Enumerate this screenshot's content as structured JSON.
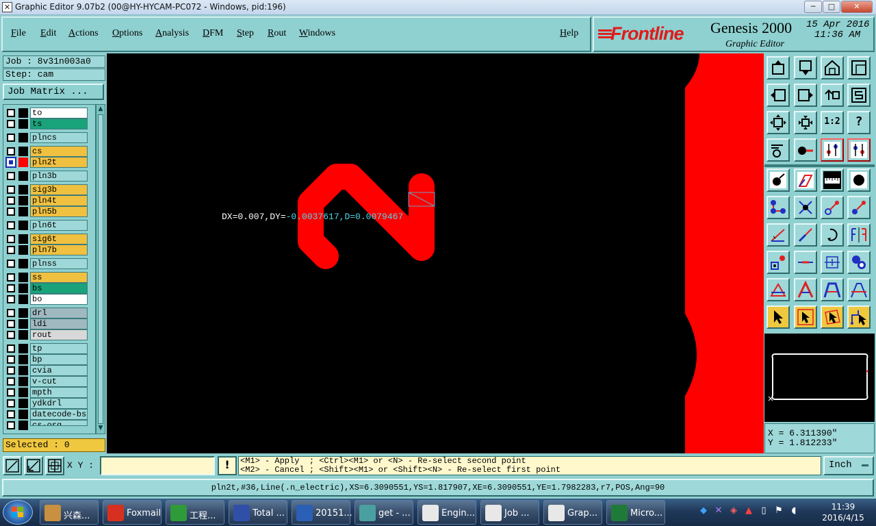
{
  "window": {
    "title": "Graphic Editor 9.07b2 (00@HY-HYCAM-PC072 - Windows, pid:196)",
    "minimize": "─",
    "maximize": "□",
    "close": "✕"
  },
  "menu": {
    "items": [
      "File",
      "Edit",
      "Actions",
      "Options",
      "Analysis",
      "DFM",
      "Step",
      "Rout",
      "Windows"
    ],
    "help": "Help"
  },
  "brand": {
    "logo": "Frontline",
    "product": "Genesis 2000",
    "subtitle": "Graphic Editor",
    "date": "15 Apr 2016",
    "time": "11:36 AM"
  },
  "job": {
    "job_line": "Job : 8v31n003a0",
    "step_line": "Step: cam",
    "matrix_button": "Job Matrix ..."
  },
  "layers": [
    {
      "name": "to",
      "color": "#ffffff"
    },
    {
      "name": "ts",
      "color": "#1aa37a"
    },
    {
      "name": "plncs",
      "color": "#9ed8d8"
    },
    {
      "name": "cs",
      "color": "#f0c040"
    },
    {
      "name": "pln2t",
      "color": "#f0c040",
      "selected": true
    },
    {
      "name": "pln3b",
      "color": "#9ed8d8"
    },
    {
      "name": "sig3b",
      "color": "#f0c040"
    },
    {
      "name": "pln4t",
      "color": "#f0c040"
    },
    {
      "name": "pln5b",
      "color": "#f0c040"
    },
    {
      "name": "pln6t",
      "color": "#9ed8d8"
    },
    {
      "name": "sig6t",
      "color": "#f0c040"
    },
    {
      "name": "pln7b",
      "color": "#f0c040"
    },
    {
      "name": "plnss",
      "color": "#9ed8d8"
    },
    {
      "name": "ss",
      "color": "#f0c040"
    },
    {
      "name": "bs",
      "color": "#1aa37a"
    },
    {
      "name": "bo",
      "color": "#ffffff"
    },
    {
      "name": "drl",
      "color": "#a0b8c0"
    },
    {
      "name": "ldi",
      "color": "#a0b8c0"
    },
    {
      "name": "rout",
      "color": "#d8d8d8"
    },
    {
      "name": "tp",
      "color": "#9ed8d8"
    },
    {
      "name": "bp",
      "color": "#9ed8d8"
    },
    {
      "name": "cvia",
      "color": "#9ed8d8"
    },
    {
      "name": "v-cut",
      "color": "#9ed8d8"
    },
    {
      "name": "mpth",
      "color": "#9ed8d8"
    },
    {
      "name": "ydkdrl",
      "color": "#9ed8d8"
    },
    {
      "name": "datecode-bs",
      "color": "#9ed8d8"
    },
    {
      "name": "cs-org",
      "color": "#9ed8d8"
    }
  ],
  "selected_count": "Selected : 0",
  "measurement": {
    "dx": "DX=0.007,DY=",
    "dy": "-0.0037617,",
    "d": "D=0.0079467"
  },
  "tools": {
    "zoom_ratio_label": "1:2",
    "help_label": "?"
  },
  "coords": {
    "x": "X = 6.311390\"",
    "y": "Y = 1.812233\""
  },
  "statusbar": {
    "xy_label": "X Y :",
    "xy_value": "",
    "warn": "!",
    "prompt_line1": "<M1> - Apply  ; <Ctrl><M1> or <N> - Re-select second point",
    "prompt_line2": "<M2> - Cancel ; <Shift><M1> or <Shift><N> - Re-select first point",
    "units": "Inch"
  },
  "feature_info": "pln2t,#36,Line(.n_electric),XS=6.3090551,YS=1.817907,XE=6.3090551,YE=1.7982283,r7,POS,Ang=90",
  "taskbar": {
    "tasks": [
      {
        "label": "兴森...",
        "icon": "#c89040"
      },
      {
        "label": "Foxmail",
        "icon": "#d83020"
      },
      {
        "label": "工程...",
        "icon": "#2f9a3a"
      },
      {
        "label": "Total ...",
        "icon": "#3050a8"
      },
      {
        "label": "20151...",
        "icon": "#2b5fb5"
      },
      {
        "label": "get - ...",
        "icon": "#4aa0a0"
      },
      {
        "label": "Engin...",
        "icon": "#e8e8e8"
      },
      {
        "label": "Job ...",
        "icon": "#e8e8e8"
      },
      {
        "label": "Grap...",
        "icon": "#e8e8e8"
      },
      {
        "label": "Micro...",
        "icon": "#1f7a3a"
      }
    ],
    "clock_time": "11:39",
    "clock_date": "2016/4/15"
  }
}
